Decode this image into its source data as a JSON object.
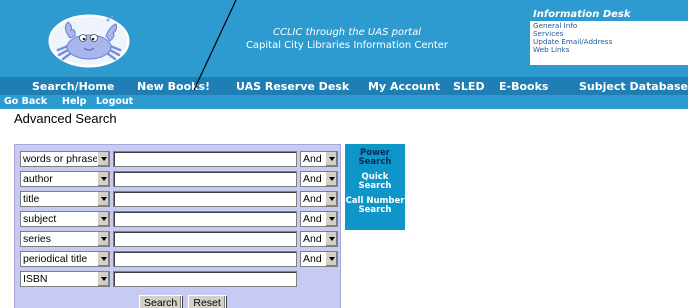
{
  "header": {
    "center_line1": "CCLIC through the UAS portal",
    "center_line2": "Capital City Libraries Information Center",
    "info_desk": {
      "title": "Information Desk",
      "links": [
        "General Info",
        "Services",
        "Update Email/Address",
        "Web Links"
      ]
    }
  },
  "nav": {
    "items": [
      "Search/Home",
      "New Books!",
      "UAS Reserve Desk",
      "My Account",
      "SLED",
      "E-Books",
      "Subject Databases"
    ]
  },
  "subnav": {
    "items": [
      "Go Back",
      "Help",
      "Logout"
    ]
  },
  "page_title": "Advanced Search",
  "search": {
    "rows": [
      {
        "field": "words or phrase",
        "value": "",
        "operator": "And"
      },
      {
        "field": "author",
        "value": "",
        "operator": "And"
      },
      {
        "field": "title",
        "value": "",
        "operator": "And"
      },
      {
        "field": "subject",
        "value": "",
        "operator": "And"
      },
      {
        "field": "series",
        "value": "",
        "operator": "And"
      },
      {
        "field": "periodical title",
        "value": "",
        "operator": "And"
      },
      {
        "field": "ISBN",
        "value": ""
      }
    ],
    "search_label": "Search",
    "reset_label": "Reset"
  },
  "side_nav": {
    "power_line1": "Power",
    "power_line2": "Search",
    "quick_line1": "Quick",
    "quick_line2": "Search",
    "callnum_line1": "Call Number",
    "callnum_line2": "Search"
  },
  "colors": {
    "header_bg": "#2e9bd0",
    "nav_bg": "#1f7fb4",
    "panel_bg": "#c7cbf3",
    "side_nav_bg": "#0f96c9"
  },
  "icons": {
    "logo": "crab-logo-icon"
  }
}
